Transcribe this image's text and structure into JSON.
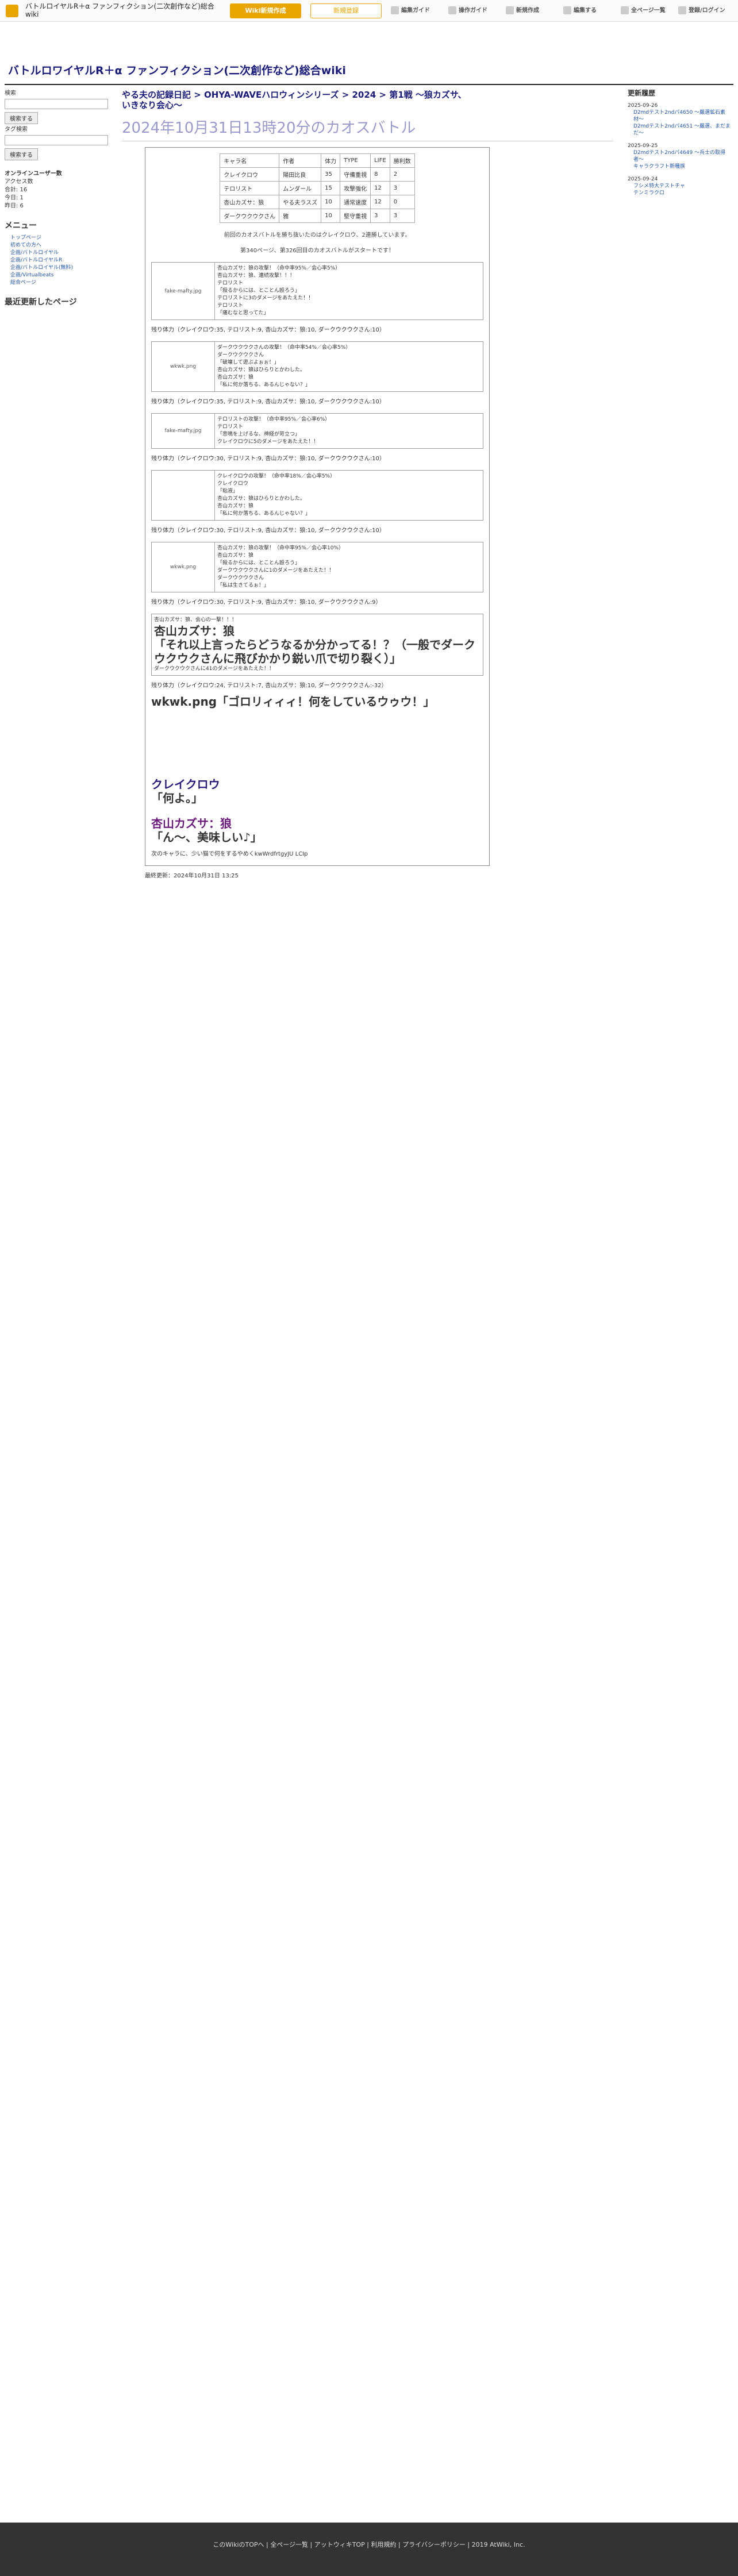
{
  "header": {
    "site": "バトルロイヤルR＋α ファンフィクション(二次創作など)総合wiki",
    "btn_a": "Wiki新規作成",
    "btn_b": "新規登録",
    "tools": [
      "編集ガイド",
      "操作ガイド",
      "新規作成",
      "編集する",
      "全ページ一覧",
      "登録/ログイン"
    ]
  },
  "title": "バトルロワイヤルR＋α ファンフィクション(二次創作など)総合wiki",
  "left": {
    "search_label": "検索",
    "search_btn": "検索する",
    "tag_label": "タグ検索",
    "tag_btn": "検索する",
    "online": "オンラインユーザー数",
    "stats": [
      "アクセス数",
      "合計: 16",
      "今日: 1",
      "昨日: 6"
    ],
    "menu": "メニュー",
    "nav": [
      "トップページ",
      "初めての方へ",
      "企画/バトルロイヤル",
      "企画/バトルロイヤルR",
      "企画/バトルロイヤル(無料)",
      "企画/Virtualbeats",
      "総合ページ"
    ],
    "recent": "最近更新したページ"
  },
  "main": {
    "breadcrumb": "やる夫の記録日記 > OHYA-WAVEハロウィンシリーズ > 2024 > 第1戦 〜狼カズサ、いきなり会心〜",
    "page_title": "2024年10月31日13時20分のカオスバトル",
    "table": [
      [
        "キャラ名",
        "作者",
        "体力",
        "TYPE",
        "LIFE",
        "勝利数"
      ],
      [
        "クレイクロウ",
        "陽田比良",
        "35",
        "守備重視",
        "8",
        "2"
      ],
      [
        "テロリスト",
        "ムンダール",
        "15",
        "攻撃強化",
        "12",
        "3"
      ],
      [
        "杏山カズサ：狼",
        "やる夫ラスズ",
        "10",
        "通常速度",
        "12",
        "0"
      ],
      [
        "ダークウクウクさん",
        "雅",
        "10",
        "堅守重視",
        "3",
        "3"
      ]
    ],
    "intro1": "前回のカオスバトルを勝ち抜いたのはクレイクロウ、2連勝しています。",
    "intro2": "第340ページ、第326回目のカオスバトルがスタートです！",
    "events": [
      {
        "who": "fake-mafty.jpg",
        "lines": [
          "杏山カズサ：狼の攻撃！（命中率95%／会心率5%）",
          "杏山カズサ：狼、連続攻撃！！！",
          "テロリスト",
          "「殺るからには、とことん殴ろう」",
          "テロリストに3のダメージをあたえた！！",
          "テロリスト",
          "「痛むなと思ってた」"
        ],
        "speed": "残り体力（クレイクロウ:35, テロリスト:9, 杏山カズサ：狼:10, ダークウクウクさん:10）"
      },
      {
        "who": "wkwk.png",
        "lines": [
          "ダークウクウクさんの攻撃！（命中率54%／会心率5%）",
          "ダークウクウクさん",
          "「破壊して遊ぶよぉぉ！」",
          "杏山カズサ：狼はひらりとかわした。",
          "杏山カズサ：狼",
          "「私に何か落ちる、あるんじゃない？」"
        ],
        "speed": "残り体力（クレイクロウ:35, テロリスト:9, 杏山カズサ：狼:10, ダークウクウクさん:10）"
      },
      {
        "who": "fake-mafty.jpg",
        "lines": [
          "テロリストの攻撃！（命中率95%／会心率6%）",
          "テロリスト",
          "「悲鳴を上げるな、神経が苛立つ」",
          "クレイクロウに5のダメージをあたえた！！"
        ],
        "speed": "残り体力（クレイクロウ:30, テロリスト:9, 杏山カズサ：狼:10, ダークウクウクさん:10）"
      },
      {
        "who": "",
        "lines": [
          "クレイクロウの攻撃！（命中率18%／会心率5%）",
          "クレイクロウ",
          "「粘液」",
          "杏山カズサ：狼はひらりとかわした。",
          "杏山カズサ：狼",
          "「私に何か落ちる、あるんじゃない？」"
        ],
        "speed": "残り体力（クレイクロウ:30, テロリスト:9, 杏山カズサ：狼:10, ダークウクウクさん:10）"
      },
      {
        "who": "wkwk.png",
        "lines": [
          "杏山カズサ：狼の攻撃！（命中率95%／会心率10%）",
          "杏山カズサ：狼",
          "「殺るからには、とことん殴ろう」",
          "ダークウクウクさんに1のダメージをあたえた！！",
          "ダークウクウクさん",
          "「私は生きてるぉ！」"
        ],
        "speed": "残り体力（クレイクロウ:30, テロリスト:9, 杏山カズサ：狼:10, ダークウクウクさん:9）"
      }
    ],
    "big_event": [
      "杏山カズサ：狼、会心の一撃！！！",
      "杏山カズサ：狼",
      "「それ以上言ったらどうなるか分かってる！？（一般でダークウクウクさんに飛びかかり鋭い爪で切り裂く）」",
      "ダークウクウクさんに41のダメージをあたえた！！"
    ],
    "big_speed": "残り体力（クレイクロウ:24, テロリスト:7, 杏山カズサ：狼:10, ダークウクウクさん:-32）",
    "defeated": "wkwk.png「ゴロリィィィ！何をしているウゥウ！」",
    "end1": "「何よ。」",
    "end2": "「ん〜、美味しい♪」",
    "winner_a": "クレイクロウ",
    "winner_b": "杏山カズサ：狼",
    "footnote": "次のキャラに、少い猫で何をするやめくkwWrdfrtgyJU  LCIp",
    "last_edit": "最終更新：2024年10月31日 13:25"
  },
  "right": {
    "title": "更新履歴",
    "groups": [
      {
        "date": "2025-09-26",
        "items": [
          "D2mdテスト2ndパ4650 〜厳選鉱石素材〜",
          "D2mdテスト2ndパ4651 〜厳選、まだまだ〜"
        ]
      },
      {
        "date": "2025-09-25",
        "items": [
          "D2mdテスト2ndパ4649 〜兵士の取得者〜",
          "キャラクラフト新種族"
        ]
      },
      {
        "date": "2025-09-24",
        "items": [
          "フシメ特大テストチャ",
          "テンミラクロ"
        ]
      }
    ]
  },
  "footer": "このWikiのTOPへ | 全ページ一覧 | アットウィキTOP | 利用規約 | プライバシーポリシー | 2019 AtWiki, Inc."
}
